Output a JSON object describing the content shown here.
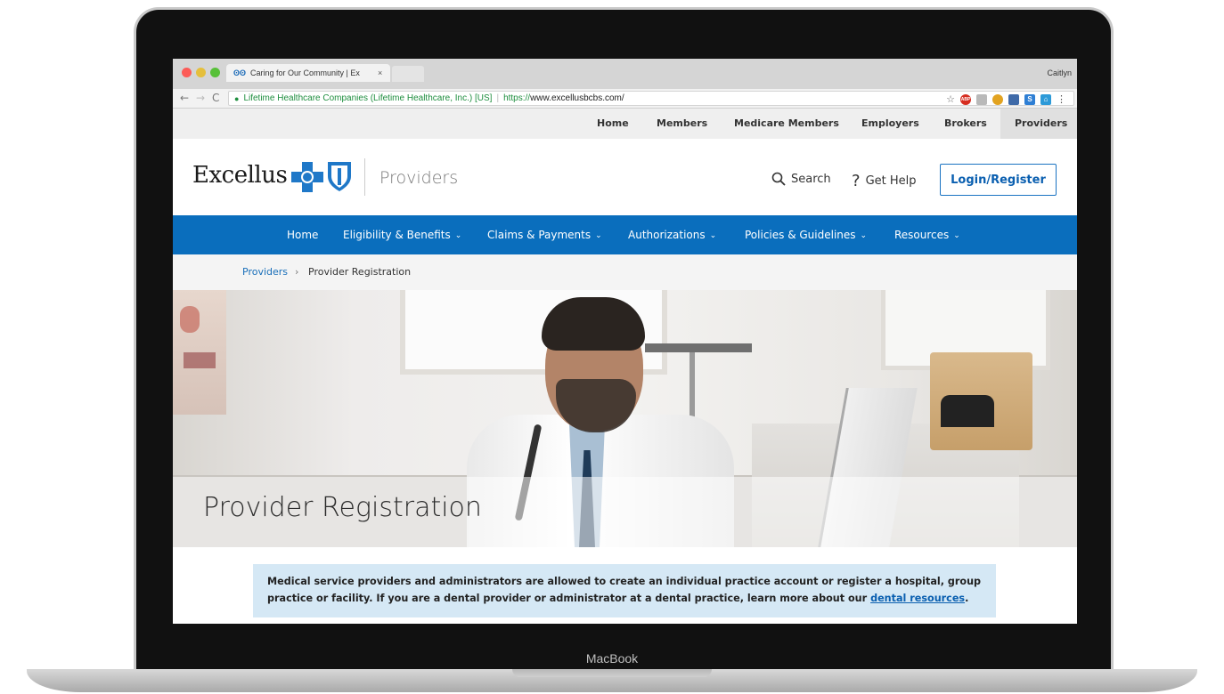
{
  "device": {
    "label": "MacBook"
  },
  "browser": {
    "tab_title": "Caring for Our Community | Ex",
    "tab_close": "×",
    "profile": "Caitlyn",
    "cert_org": "Lifetime Healthcare Companies (Lifetime Healthcare, Inc.) [US]",
    "url_proto": "https://",
    "url_host": "www.excellusbcbs.com/",
    "nav_back": "←",
    "nav_forward": "→",
    "nav_reload": "C",
    "extensions": [
      {
        "name": "adblock-icon",
        "text": "ABP",
        "color": "#d62d20"
      },
      {
        "name": "extension-gray-icon",
        "text": "",
        "color": "#b9b9b9"
      },
      {
        "name": "extension-person-icon",
        "text": "",
        "color": "#e2a321"
      },
      {
        "name": "extension-calendar-icon",
        "text": "",
        "color": "#3f6aa8"
      },
      {
        "name": "extension-s-icon",
        "text": "S",
        "color": "#2f7fd4"
      },
      {
        "name": "extension-home-icon",
        "text": "",
        "color": "#2d9ad8"
      }
    ],
    "menu_icon": "⋮"
  },
  "utility_nav": {
    "items": [
      "Home",
      "Members",
      "Medicare Members",
      "Employers",
      "Brokers",
      "Providers"
    ],
    "active": "Providers"
  },
  "header": {
    "logo_text": "Excellus",
    "section": "Providers",
    "search_label": "Search",
    "help_label": "Get Help",
    "login_label": "Login/Register"
  },
  "main_nav": {
    "items": [
      {
        "label": "Home",
        "dropdown": false
      },
      {
        "label": "Eligibility & Benefits",
        "dropdown": true
      },
      {
        "label": "Claims & Payments",
        "dropdown": true
      },
      {
        "label": "Authorizations",
        "dropdown": true
      },
      {
        "label": "Policies & Guidelines",
        "dropdown": true
      },
      {
        "label": "Resources",
        "dropdown": true
      }
    ]
  },
  "breadcrumb": {
    "parent": "Providers",
    "separator": "›",
    "current": "Provider Registration"
  },
  "hero": {
    "title": "Provider Registration"
  },
  "notice": {
    "text": "Medical service providers and administrators are allowed to create an individual practice account or register a hospital, group practice or facility. If you are a dental provider or administrator at a dental practice, learn more about our ",
    "link_text": "dental resources",
    "suffix": "."
  },
  "colors": {
    "brand_blue": "#0a6ebd",
    "link_blue": "#1a6fb9",
    "notice_bg": "#d5e8f5"
  }
}
